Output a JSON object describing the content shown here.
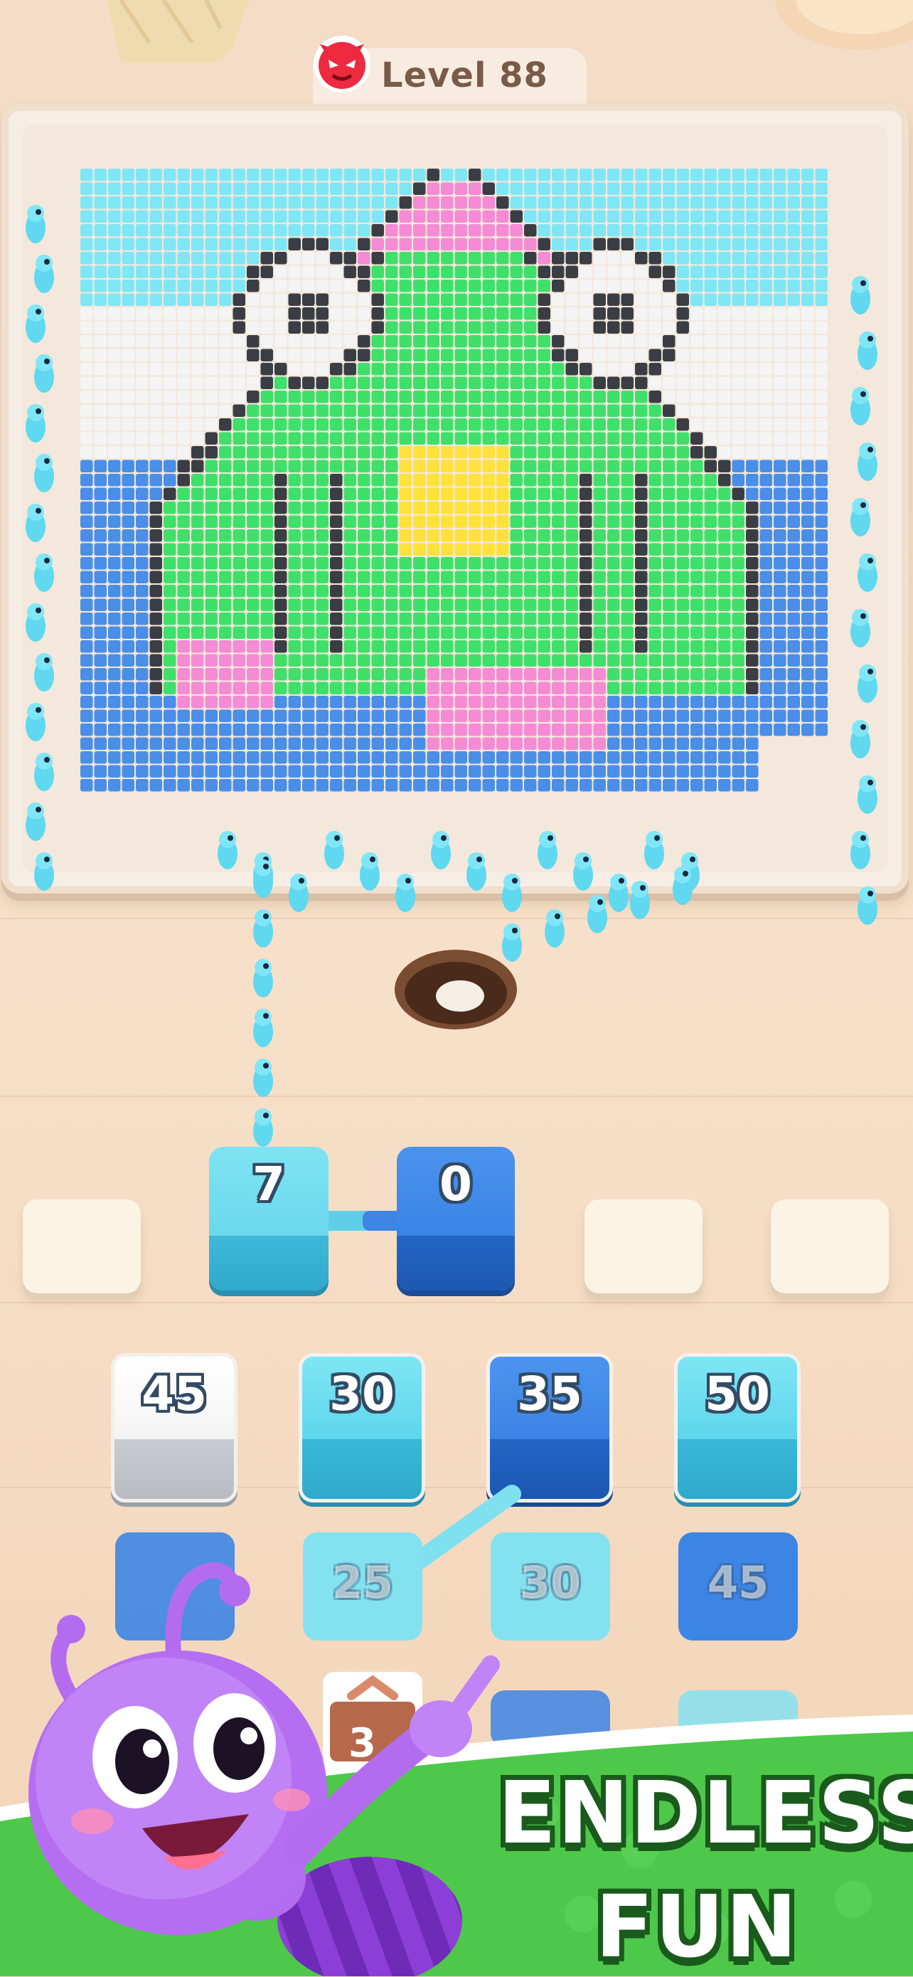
{
  "header": {
    "level_label": "Level 88",
    "level_icon": "devil-face-icon"
  },
  "queue": {
    "slots": [
      "",
      "7",
      "0",
      "",
      ""
    ],
    "slot_colors": [
      "empty",
      "#5ed3ea",
      "#3d86e6",
      "empty",
      "empty"
    ]
  },
  "grid": {
    "row1": [
      {
        "value": "45",
        "color": "#f4f4f4"
      },
      {
        "value": "30",
        "color": "#56d2e6"
      },
      {
        "value": "35",
        "color": "#3c82e2"
      },
      {
        "value": "50",
        "color": "#56d2e6"
      }
    ],
    "row2": [
      {
        "value": "",
        "color": "#3c82e2"
      },
      {
        "value": "25",
        "color": "#7fe4f0"
      },
      {
        "value": "30",
        "color": "#7fe4f0"
      },
      {
        "value": "45",
        "color": "#3c82e2"
      }
    ]
  },
  "badge": {
    "value": "3"
  },
  "promo": {
    "line1": "ENDLESS",
    "line2": "FUN"
  },
  "colors": {
    "sky": "#7fe6f5",
    "cloud": "#f4f4f4",
    "water": "#4a8ee8",
    "frog": "#3fe06a",
    "outline": "#3a3e44",
    "crown": "#f58bd4",
    "belly": "#ffe13b",
    "lotus": "#f58bd4",
    "banner_green": "#4ec84a"
  },
  "icons": [
    "devil-face-icon",
    "ant-icon",
    "hole-icon",
    "ant-mascot-icon",
    "cake-icon"
  ]
}
